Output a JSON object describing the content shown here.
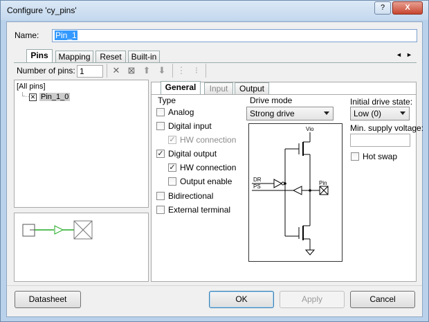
{
  "window": {
    "title": "Configure 'cy_pins'",
    "help_label": "?",
    "close_label": "X"
  },
  "name": {
    "label": "Name:",
    "value": "Pin_1"
  },
  "main_tabs": [
    {
      "label": "Pins"
    },
    {
      "label": "Mapping"
    },
    {
      "label": "Reset"
    },
    {
      "label": "Built-in"
    }
  ],
  "tab_scroll": {
    "left": "◄",
    "right": "►"
  },
  "toolbar": {
    "num_pins_label": "Number of pins:",
    "num_pins_value": "1"
  },
  "tree": {
    "root": "[All pins]",
    "child": "Pin_1_0"
  },
  "sub_tabs": [
    {
      "label": "General"
    },
    {
      "label": "Input"
    },
    {
      "label": "Output"
    }
  ],
  "type_group": {
    "title": "Type",
    "options": [
      {
        "label": "Analog",
        "checked": false,
        "disabled": false
      },
      {
        "label": "Digital input",
        "checked": false,
        "disabled": false
      },
      {
        "label": "HW connection",
        "checked": true,
        "disabled": true
      },
      {
        "label": "Digital output",
        "checked": true,
        "disabled": false
      },
      {
        "label": "HW connection",
        "checked": true,
        "disabled": false
      },
      {
        "label": "Output enable",
        "checked": false,
        "disabled": false
      },
      {
        "label": "Bidirectional",
        "checked": false,
        "disabled": false
      },
      {
        "label": "External terminal",
        "checked": false,
        "disabled": false
      }
    ]
  },
  "drive_mode": {
    "title": "Drive mode",
    "value": "Strong drive"
  },
  "schematic": {
    "vio": "Vio",
    "dr": "DR",
    "ps": "PS",
    "pin": "Pin"
  },
  "initial_drive": {
    "label": "Initial drive state:",
    "value": "Low (0)"
  },
  "min_supply": {
    "label": "Min. supply voltage:",
    "value": ""
  },
  "hot_swap": {
    "label": "Hot swap",
    "checked": false
  },
  "buttons": {
    "datasheet": "Datasheet",
    "ok": "OK",
    "apply": "Apply",
    "cancel": "Cancel"
  },
  "colors": {
    "wire_green": "#22aa22",
    "accent": "#3399ff"
  }
}
